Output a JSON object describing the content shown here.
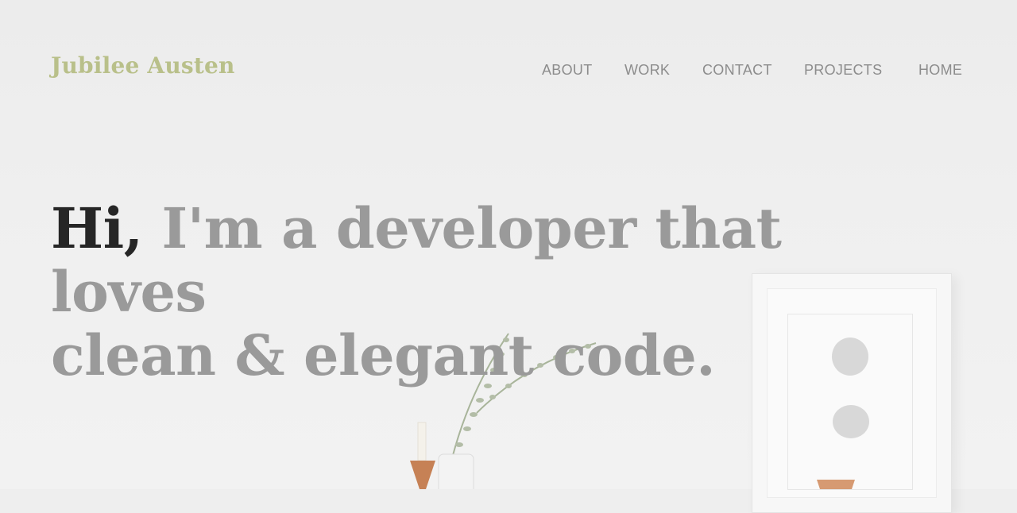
{
  "header": {
    "brand": "Jubilee Austen",
    "nav": [
      {
        "label": "ABOUT"
      },
      {
        "label": "WORK"
      },
      {
        "label": "CONTACT"
      },
      {
        "label": "PROJECTS"
      },
      {
        "label": "HOME"
      }
    ]
  },
  "hero": {
    "greeting": "Hi,",
    "line1_rest": " I'm a developer that loves",
    "line2": "clean & elegant code."
  },
  "colors": {
    "brand": "#b9c08a",
    "nav": "#8c8c8c",
    "heading_dark": "#262626",
    "heading_light": "#9a9a9a"
  }
}
